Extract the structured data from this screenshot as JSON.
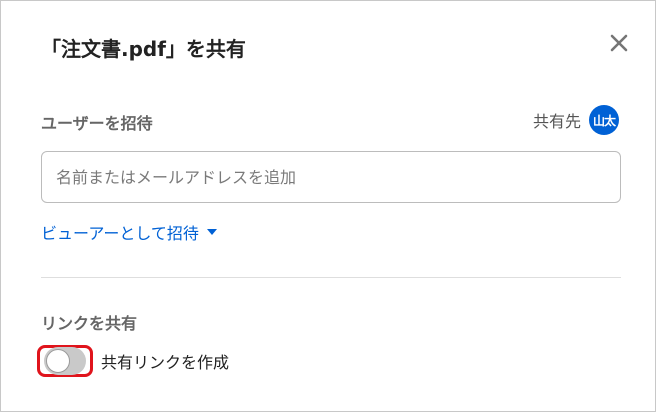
{
  "dialog": {
    "title": "「注文書.pdf」を共有",
    "close_icon": "close-icon"
  },
  "invite": {
    "label": "ユーザーを招待",
    "shared_with_label": "共有先",
    "avatar_text": "山太",
    "avatar_color": "#0061d5",
    "input_placeholder": "名前またはメールアドレスを追加",
    "input_value": "",
    "role_label": "ビューアーとして招待",
    "role_icon": "caret-down-icon"
  },
  "share_link": {
    "label": "リンクを共有",
    "toggle_label": "共有リンクを作成",
    "toggle_on": false,
    "highlight_color": "#e0141c"
  }
}
